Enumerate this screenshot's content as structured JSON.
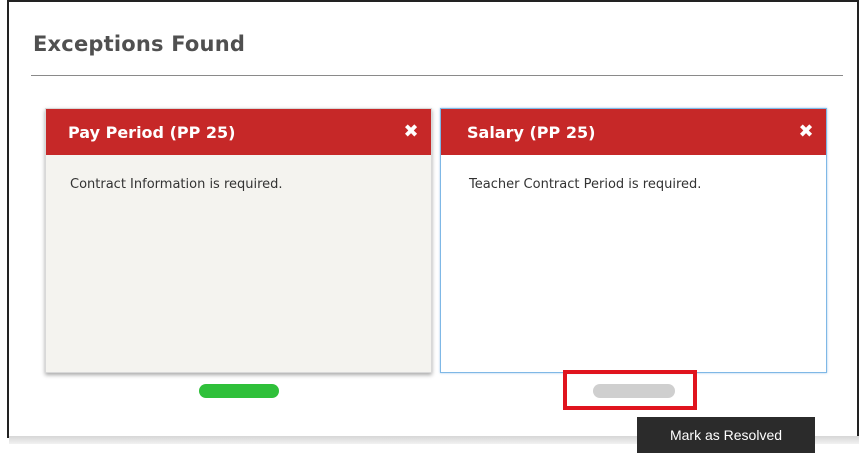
{
  "section": {
    "title": "Exceptions Found"
  },
  "cards": [
    {
      "title": "Pay Period (PP 25)",
      "close_glyph": "✖",
      "message": "Contract Information is required.",
      "status_color": "#2fc03a"
    },
    {
      "title": "Salary (PP 25)",
      "close_glyph": "✖",
      "message": "Teacher Contract Period is required.",
      "status_color": "#cfcfcf"
    }
  ],
  "tooltip": {
    "text": "Mark as Resolved"
  },
  "colors": {
    "card_header": "#c62828",
    "highlight": "#e0141e",
    "resolved": "#2fc03a",
    "unresolved": "#cfcfcf"
  }
}
